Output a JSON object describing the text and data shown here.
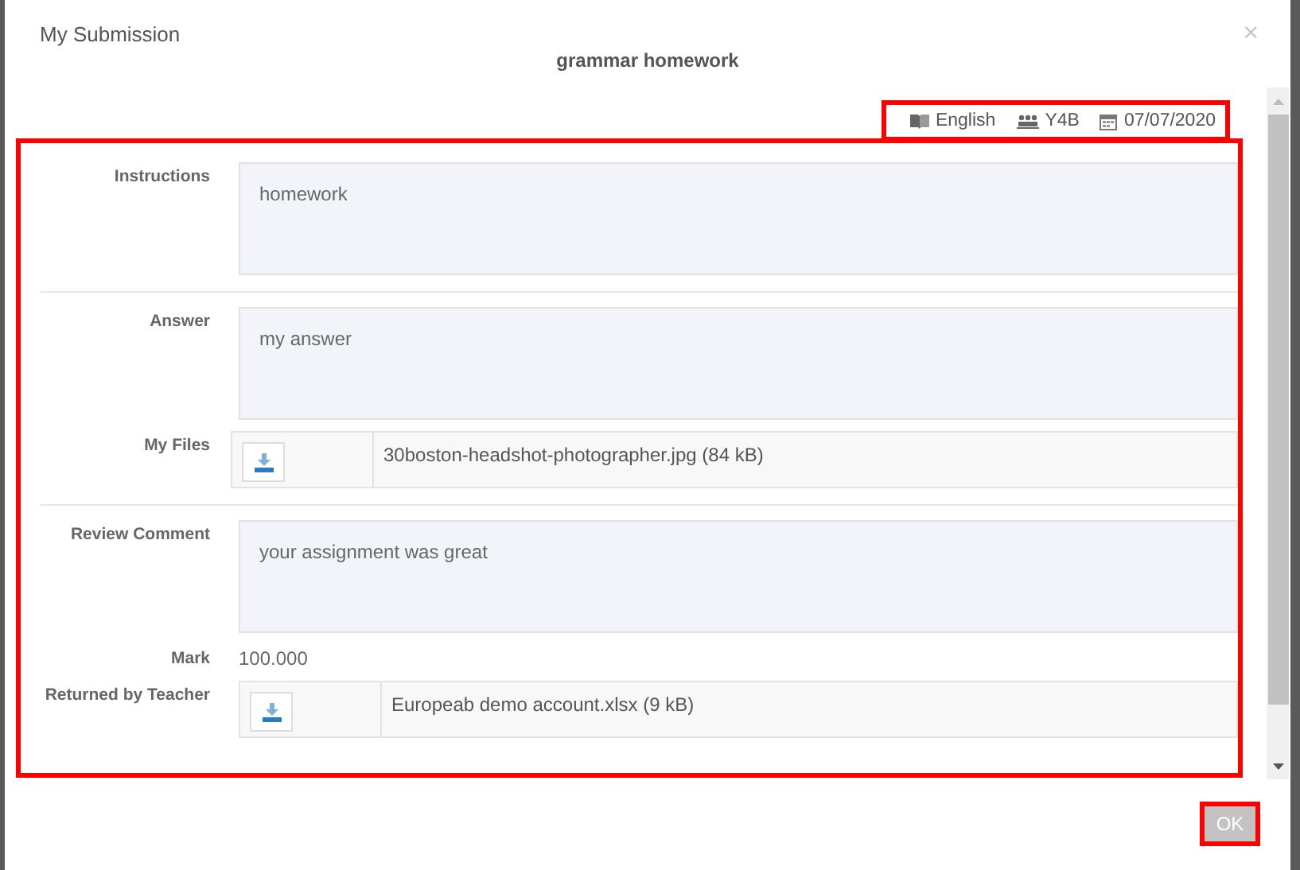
{
  "dialog": {
    "title": "My Submission",
    "close": "×",
    "subtitle": "grammar homework"
  },
  "meta": {
    "highlighted": true,
    "items": [
      {
        "kind": "subject",
        "text": "English"
      },
      {
        "kind": "class",
        "text": "Y4B"
      },
      {
        "kind": "date",
        "text": "07/07/2020"
      }
    ]
  },
  "form": {
    "highlighted": true,
    "sections": [
      [
        {
          "kind": "textbox",
          "label": "Instructions",
          "value": "homework"
        }
      ],
      [
        {
          "kind": "textbox",
          "label": "Answer",
          "value": "my answer"
        },
        {
          "kind": "files",
          "label": "My Files",
          "file": "30boston-headshot-photographer.jpg (84 kB)"
        }
      ],
      [
        {
          "kind": "textbox",
          "label": "Review Comment",
          "value": "your assignment was great"
        },
        {
          "kind": "text",
          "label": "Mark",
          "value": "100.000"
        },
        {
          "kind": "files",
          "label": "Returned by Teacher",
          "file": "Europeab demo account.xlsx (9 kB)"
        }
      ]
    ]
  },
  "ok_button": {
    "label": "OK",
    "highlighted": true
  }
}
